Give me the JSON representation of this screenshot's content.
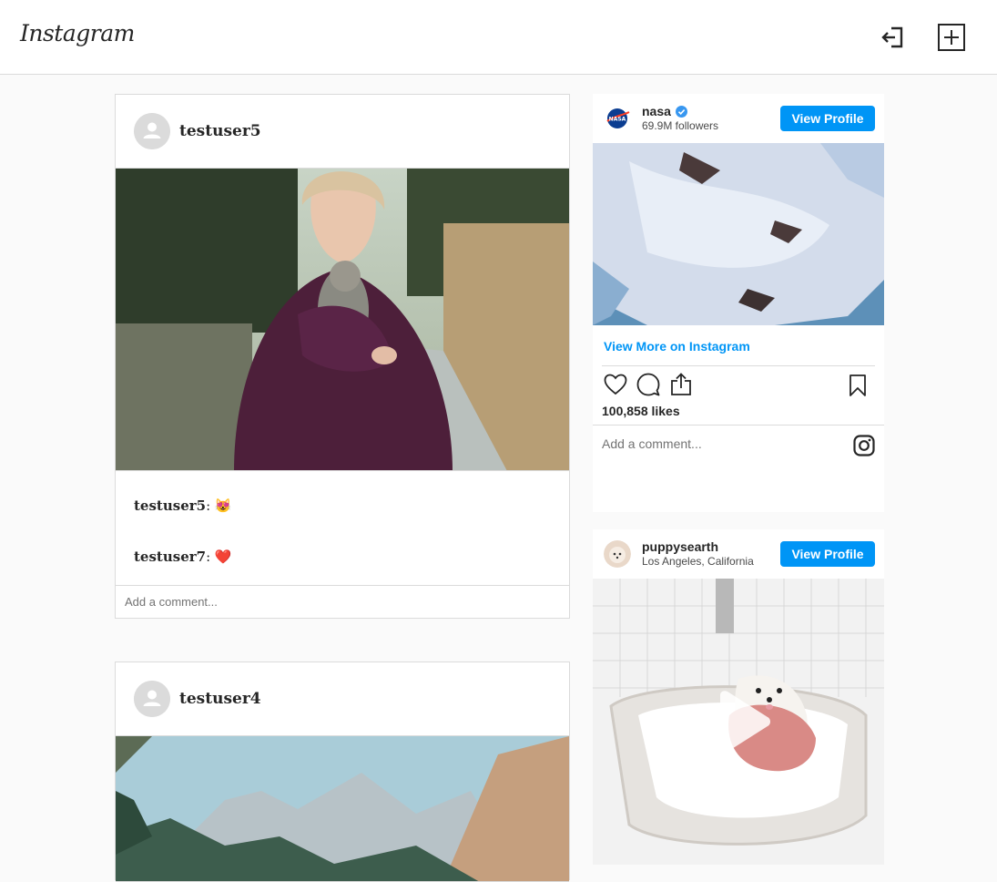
{
  "header": {
    "logo": "Instagram",
    "logout_icon": "logout-icon",
    "add_icon": "add-post-icon"
  },
  "feed": {
    "posts": [
      {
        "username": "testuser5",
        "avatar_icon": "default-avatar-icon",
        "image_description": "woman-holding-kitten-photo",
        "comments": [
          {
            "user": "testuser5",
            "text": "😻"
          },
          {
            "user": "testuser7",
            "text": "❤️"
          }
        ],
        "comment_placeholder": "Add a comment..."
      },
      {
        "username": "testuser4",
        "avatar_icon": "default-avatar-icon",
        "image_description": "mountain-valley-photo"
      }
    ]
  },
  "sidebar": {
    "embeds": [
      {
        "username": "nasa",
        "verified": true,
        "subtitle": "69.9M followers",
        "button": "View Profile",
        "view_more": "View More on Instagram",
        "likes": "100,858 likes",
        "comment_placeholder": "Add a comment..."
      },
      {
        "username": "puppysearth",
        "subtitle": "Los Angeles, California",
        "button": "View Profile"
      }
    ]
  },
  "colors": {
    "accent": "#0095f6",
    "border": "#dbdbdb",
    "background": "#fafafa"
  }
}
